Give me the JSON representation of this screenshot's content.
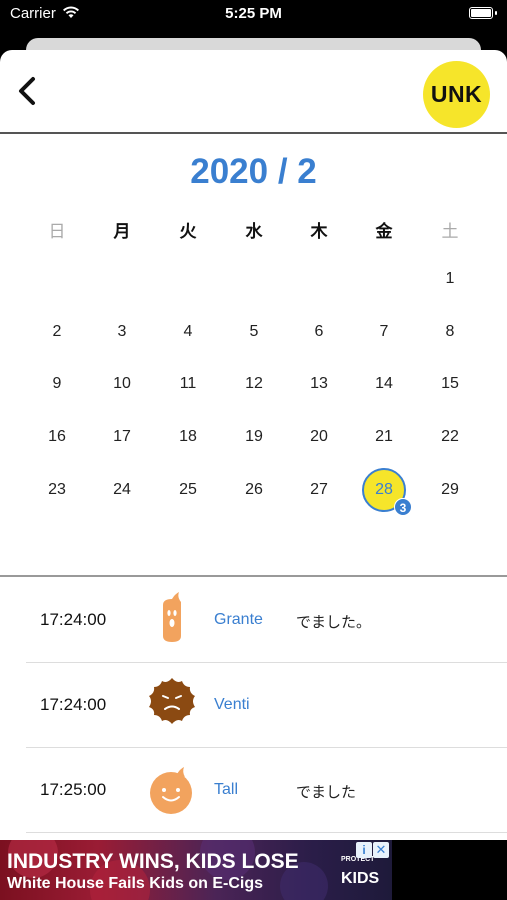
{
  "status_bar": {
    "carrier": "Carrier",
    "time": "5:25 PM",
    "battery_level": 1.0
  },
  "header": {
    "logo_text": "UNK"
  },
  "calendar": {
    "month_title": "2020 / 2",
    "weekdays": [
      "日",
      "月",
      "火",
      "水",
      "木",
      "金",
      "土"
    ],
    "weeks": [
      [
        "",
        "",
        "",
        "",
        "",
        "",
        "1"
      ],
      [
        "2",
        "3",
        "4",
        "5",
        "6",
        "7",
        "8"
      ],
      [
        "9",
        "10",
        "11",
        "12",
        "13",
        "14",
        "15"
      ],
      [
        "16",
        "17",
        "18",
        "19",
        "20",
        "21",
        "22"
      ],
      [
        "23",
        "24",
        "25",
        "26",
        "27",
        "28",
        "29"
      ]
    ],
    "selected_day": "28",
    "selected_badge": "3"
  },
  "log": [
    {
      "time": "17:24:00",
      "icon": "grante-poop-icon",
      "size": "Grante",
      "note": "でました。"
    },
    {
      "time": "17:24:00",
      "icon": "venti-poop-icon",
      "size": "Venti",
      "note": ""
    },
    {
      "time": "17:25:00",
      "icon": "tall-poop-icon",
      "size": "Tall",
      "note": "でました"
    }
  ],
  "ad": {
    "headline": "INDUSTRY WINS, KIDS LOSE",
    "subheadline": "White House Fails Kids on E-Cigs",
    "brand_top": "PROTECT",
    "brand": "KIDS",
    "info_icon": "i",
    "close_icon": "✕"
  },
  "colors": {
    "accent": "#3a7fd0",
    "highlight": "#f6e52a",
    "grante": "#f2a35e",
    "venti": "#8b4a12",
    "tall": "#f2a35e"
  }
}
